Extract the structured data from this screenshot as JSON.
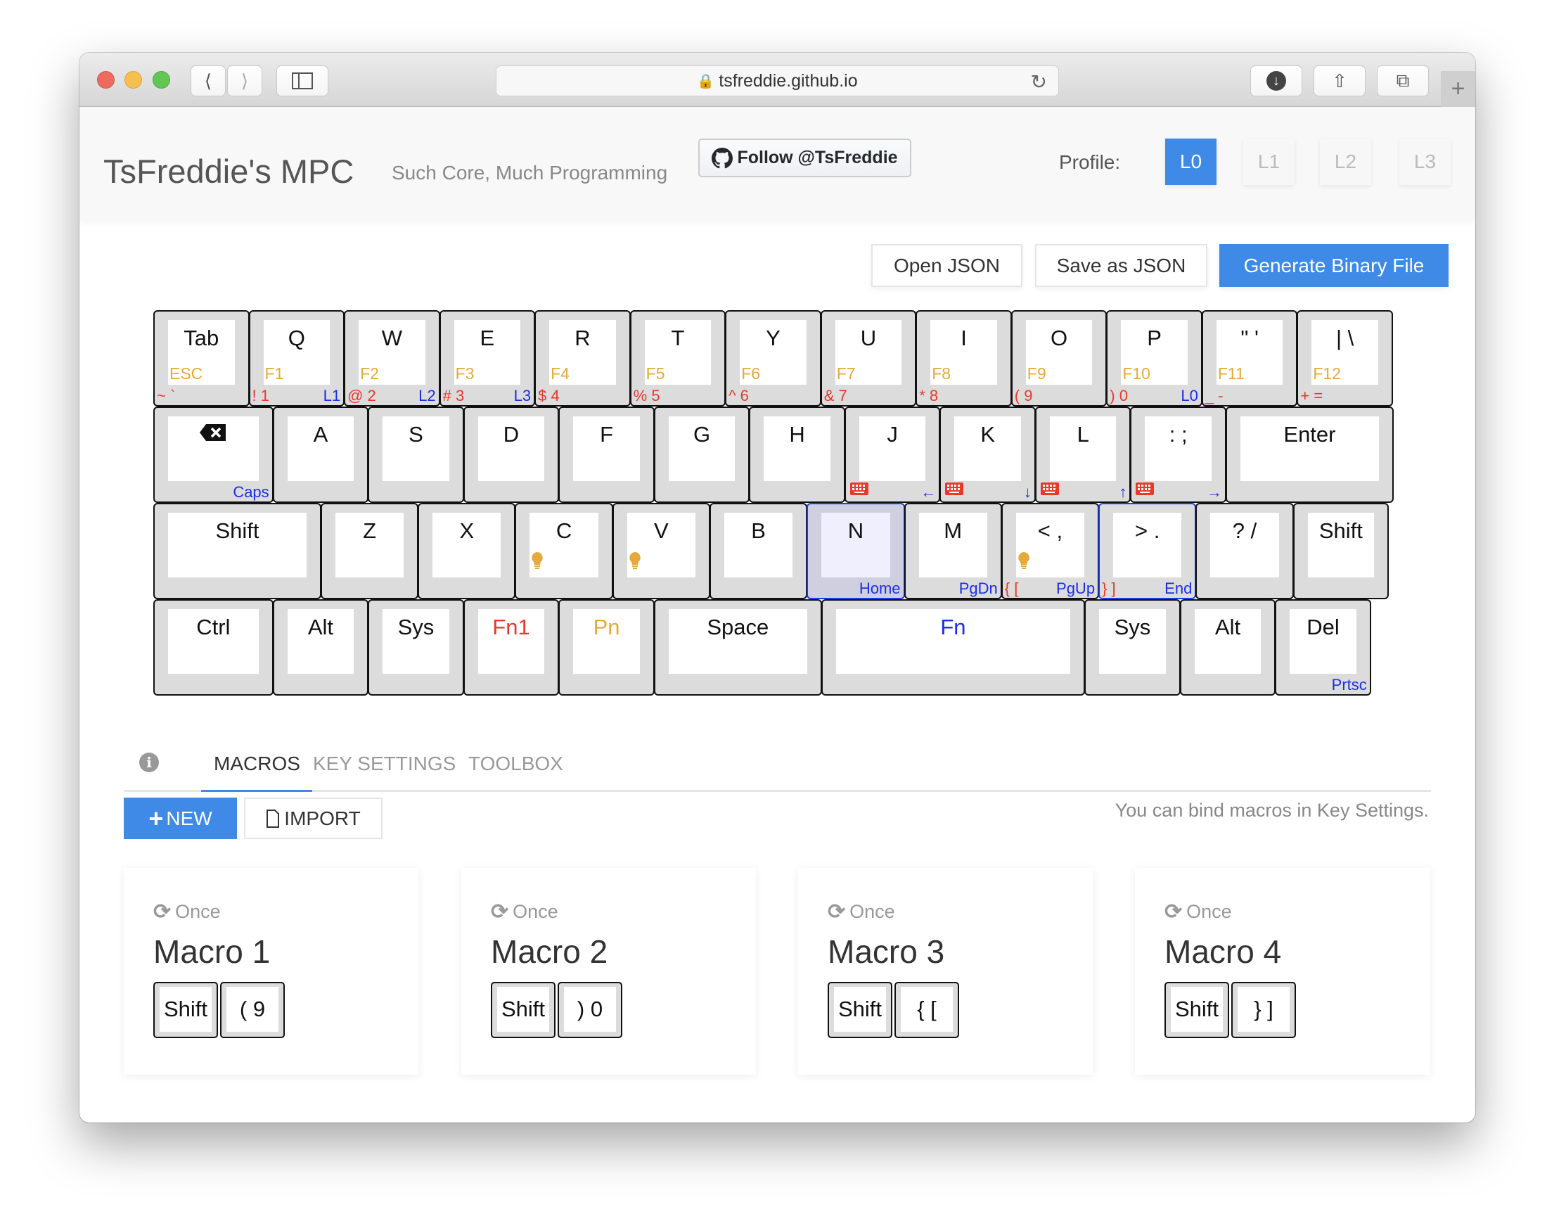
{
  "browser": {
    "url": "tsfreddie.github.io"
  },
  "header": {
    "title": "TsFreddie's MPC",
    "subtitle": "Such Core, Much Programming",
    "follow_label": "Follow @TsFreddie",
    "profile_label": "Profile:",
    "profiles": [
      "L0",
      "L1",
      "L2",
      "L3"
    ],
    "active_profile": "L0"
  },
  "actions": {
    "open": "Open JSON",
    "save": "Save as JSON",
    "generate": "Generate Binary File"
  },
  "colors": {
    "accent": "#3e8ae6",
    "fn_orange": "#e6a93a",
    "shift_red": "#e8392a",
    "layer_blue": "#1a2ee8"
  },
  "keyboard": {
    "rows": [
      [
        {
          "label": "Tab",
          "sub": "ESC",
          "left": "~ `"
        },
        {
          "label": "Q",
          "sub": "F1",
          "left": "! 1",
          "right": "L1"
        },
        {
          "label": "W",
          "sub": "F2",
          "left": "@ 2",
          "right": "L2"
        },
        {
          "label": "E",
          "sub": "F3",
          "left": "# 3",
          "right": "L3"
        },
        {
          "label": "R",
          "sub": "F4",
          "left": "$ 4"
        },
        {
          "label": "T",
          "sub": "F5",
          "left": "% 5"
        },
        {
          "label": "Y",
          "sub": "F6",
          "left": "^ 6"
        },
        {
          "label": "U",
          "sub": "F7",
          "left": "& 7"
        },
        {
          "label": "I",
          "sub": "F8",
          "left": "* 8"
        },
        {
          "label": "O",
          "sub": "F9",
          "left": "( 9"
        },
        {
          "label": "P",
          "sub": "F10",
          "left": ") 0",
          "right": "L0"
        },
        {
          "label": "\" '",
          "sub": "F11",
          "left": "_ -"
        },
        {
          "label": "| \\",
          "sub": "F12",
          "left": "+ ="
        }
      ],
      [
        {
          "label": "",
          "icon": "backspace-icon",
          "right": "Caps"
        },
        {
          "label": "A"
        },
        {
          "label": "S"
        },
        {
          "label": "D"
        },
        {
          "label": "F"
        },
        {
          "label": "G"
        },
        {
          "label": "H"
        },
        {
          "label": "J",
          "icon": "keyboard-icon",
          "right": "←"
        },
        {
          "label": "K",
          "icon": "keyboard-icon",
          "right": "↓"
        },
        {
          "label": "L",
          "icon": "keyboard-icon",
          "right": "↑"
        },
        {
          "label": ": ;",
          "icon": "keyboard-icon",
          "right": "→"
        },
        {
          "label": "Enter"
        }
      ],
      [
        {
          "label": "Shift"
        },
        {
          "label": "Z"
        },
        {
          "label": "X"
        },
        {
          "label": "C",
          "icon": "bulb-icon"
        },
        {
          "label": "V",
          "icon": "bulb-icon"
        },
        {
          "label": "B"
        },
        {
          "label": "N",
          "right": "Home",
          "state": "selected"
        },
        {
          "label": "M",
          "right": "PgDn"
        },
        {
          "label": "< ,",
          "icon": "bulb-icon",
          "left": "{ [",
          "right": "PgUp"
        },
        {
          "label": "> .",
          "left": "} ]",
          "right": "End",
          "state": "hover"
        },
        {
          "label": "? /"
        },
        {
          "label": "Shift"
        }
      ],
      [
        {
          "label": "Ctrl"
        },
        {
          "label": "Alt"
        },
        {
          "label": "Sys"
        },
        {
          "label": "Fn1",
          "label_color": "#e8392a"
        },
        {
          "label": "Pn",
          "label_color": "#e6a93a"
        },
        {
          "label": "Space"
        },
        {
          "label": "Fn",
          "label_color": "#1a2ee8"
        },
        {
          "label": "Sys"
        },
        {
          "label": "Alt"
        },
        {
          "label": "Del",
          "right": "Prtsc"
        }
      ]
    ]
  },
  "tabs": {
    "items": [
      "MACROS",
      "KEY SETTINGS",
      "TOOLBOX"
    ],
    "active": "MACROS"
  },
  "macros": {
    "new_label": "NEW",
    "import_label": "IMPORT",
    "hint": "You can bind macros in Key Settings.",
    "cards": [
      {
        "mode": "Once",
        "name": "Macro 1",
        "keys": [
          "Shift",
          "( 9"
        ]
      },
      {
        "mode": "Once",
        "name": "Macro 2",
        "keys": [
          "Shift",
          ") 0"
        ]
      },
      {
        "mode": "Once",
        "name": "Macro 3",
        "keys": [
          "Shift",
          "{ ["
        ]
      },
      {
        "mode": "Once",
        "name": "Macro 4",
        "keys": [
          "Shift",
          "} ]"
        ]
      }
    ]
  }
}
